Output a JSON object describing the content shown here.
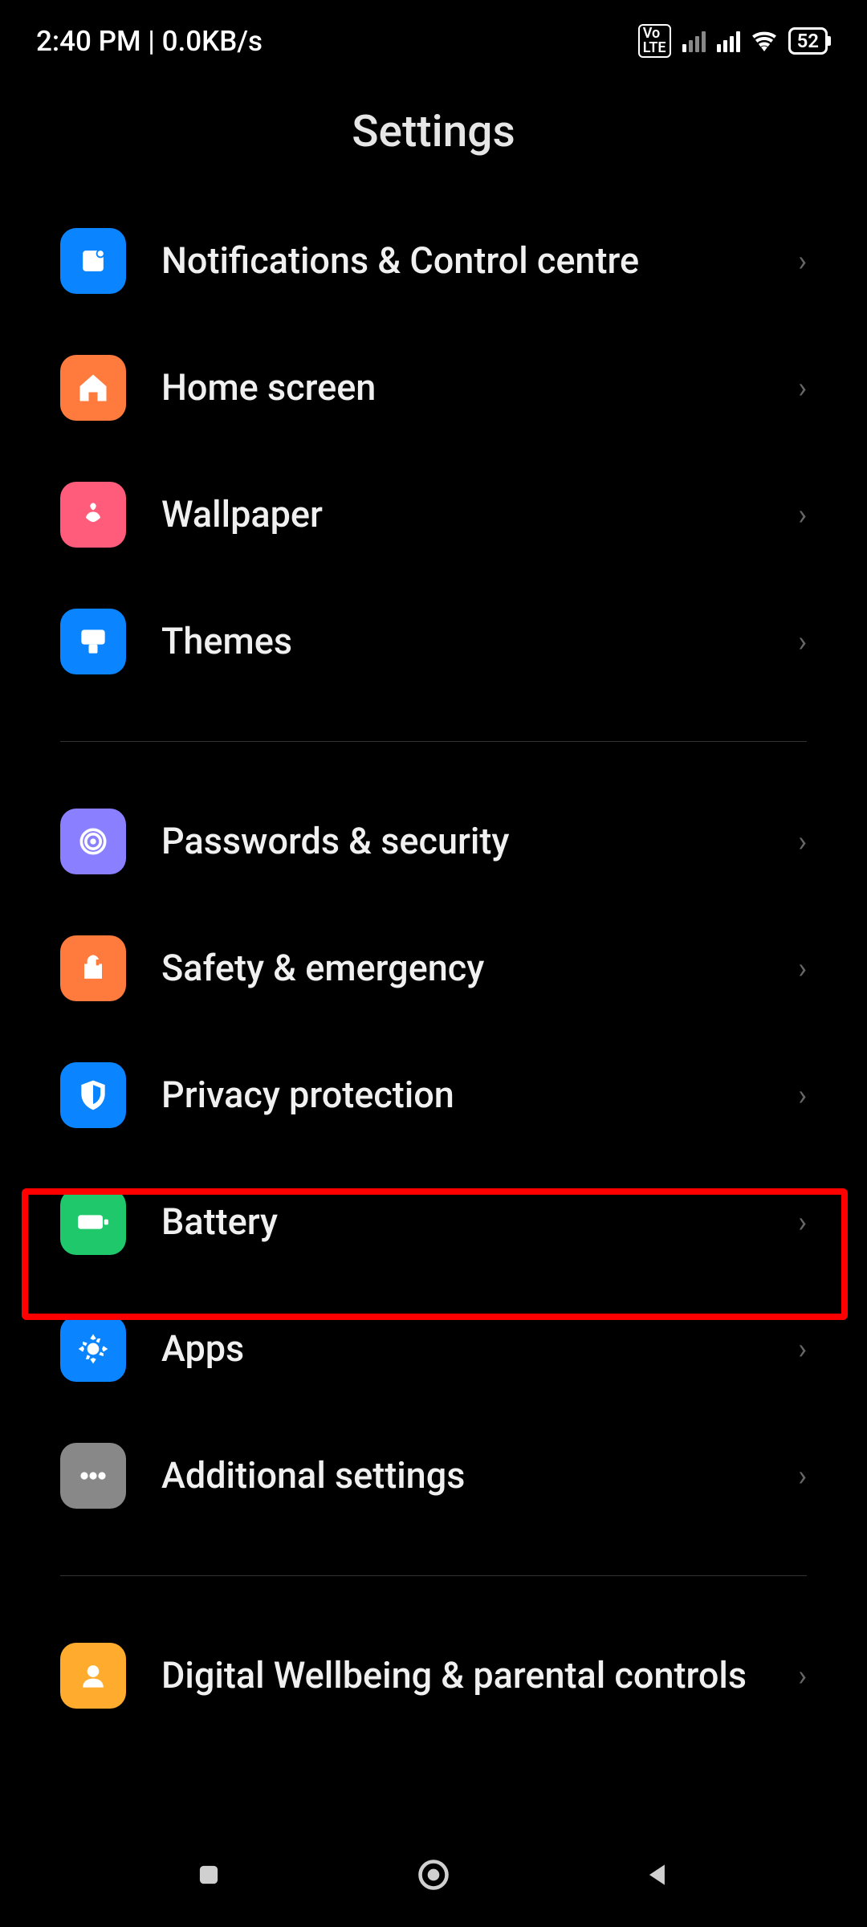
{
  "statusBar": {
    "time": "2:40 PM",
    "dataRate": "0.0KB/s",
    "batteryPercent": "52"
  },
  "pageTitle": "Settings",
  "groups": [
    {
      "items": [
        {
          "key": "notifications",
          "label": "Notifications & Control centre",
          "iconClass": "ic-notifications"
        },
        {
          "key": "homescreen",
          "label": "Home screen",
          "iconClass": "ic-home"
        },
        {
          "key": "wallpaper",
          "label": "Wallpaper",
          "iconClass": "ic-wallpaper"
        },
        {
          "key": "themes",
          "label": "Themes",
          "iconClass": "ic-themes"
        }
      ]
    },
    {
      "items": [
        {
          "key": "passwords",
          "label": "Passwords & security",
          "iconClass": "ic-passwords"
        },
        {
          "key": "safety",
          "label": "Safety & emergency",
          "iconClass": "ic-safety"
        },
        {
          "key": "privacy",
          "label": "Privacy protection",
          "iconClass": "ic-privacy"
        },
        {
          "key": "battery",
          "label": "Battery",
          "iconClass": "ic-battery",
          "highlighted": true
        },
        {
          "key": "apps",
          "label": "Apps",
          "iconClass": "ic-apps"
        },
        {
          "key": "additional",
          "label": "Additional settings",
          "iconClass": "ic-additional"
        }
      ]
    },
    {
      "items": [
        {
          "key": "wellbeing",
          "label": "Digital Wellbeing & parental controls",
          "iconClass": "ic-wellbeing"
        }
      ]
    }
  ]
}
